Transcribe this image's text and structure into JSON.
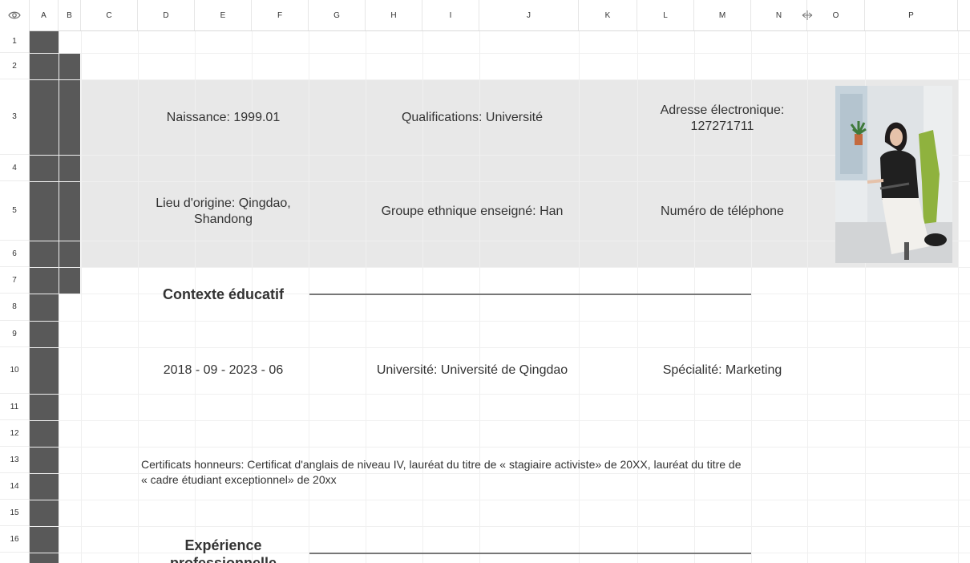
{
  "columns": [
    "A",
    "B",
    "C",
    "D",
    "E",
    "F",
    "G",
    "H",
    "I",
    "J",
    "K",
    "L",
    "M",
    "N",
    "O",
    "P"
  ],
  "rows": [
    "1",
    "2",
    "3",
    "4",
    "5",
    "6",
    "7",
    "8",
    "9",
    "10",
    "11",
    "12",
    "13",
    "14",
    "15",
    "16"
  ],
  "info": {
    "naissance": "Naissance: 1999.01",
    "qualifications": "Qualifications: Université",
    "email_label": "Adresse électronique:",
    "email_value": "127271711",
    "origine_line1": "Lieu d'origine: Qingdao,",
    "origine_line2": "Shandong",
    "ethnique": "Groupe ethnique enseigné: Han",
    "telephone": "Numéro de téléphone"
  },
  "education": {
    "heading": "Contexte éducatif",
    "period": "2018 - 09 - 2023 - 06",
    "university": "Université: Université de Qingdao",
    "specialty": "Spécialité: Marketing"
  },
  "certificates": {
    "line1": "Certificats honneurs: Certificat d'anglais de niveau IV, lauréat du titre de « stagiaire activiste» de 20XX, lauréat du titre de",
    "line2": "« cadre étudiant exceptionnel» de 20xx"
  },
  "experience": {
    "heading_line1": "Expérience",
    "heading_line2": "professionnelle"
  },
  "colors": {
    "dark_bar": "#595959",
    "band": "#e8e8e8",
    "text": "#333333"
  }
}
